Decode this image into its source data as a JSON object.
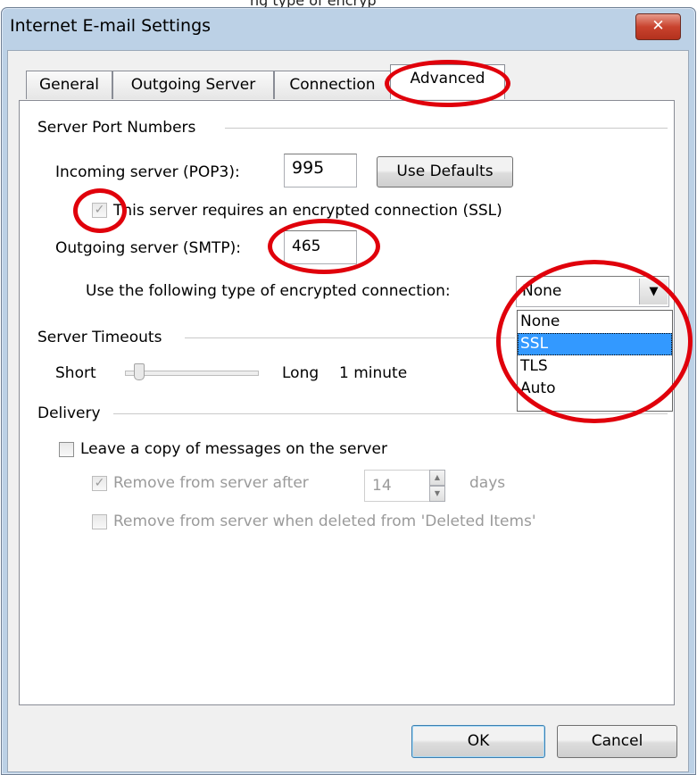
{
  "clipped_caption": "ng type of encryp",
  "window": {
    "title": "Internet E-mail Settings",
    "close_glyph": "✕"
  },
  "tabs": [
    {
      "label": "General",
      "active": false
    },
    {
      "label": "Outgoing Server",
      "active": false
    },
    {
      "label": "Connection",
      "active": false
    },
    {
      "label": "Advanced",
      "active": true
    }
  ],
  "server_ports": {
    "group_label": "Server Port Numbers",
    "incoming_label": "Incoming server (POP3):",
    "incoming_value": "995",
    "use_defaults_label": "Use Defaults",
    "ssl_required": {
      "label": "This server requires an encrypted connection (SSL)",
      "checked": true,
      "enabled": false
    },
    "outgoing_label": "Outgoing server (SMTP):",
    "outgoing_value": "465",
    "encryption_label": "Use the following type of encrypted connection:",
    "encryption_selected": "None",
    "encryption_options": [
      "None",
      "SSL",
      "TLS",
      "Auto"
    ],
    "encryption_highlighted": "SSL"
  },
  "timeouts": {
    "group_label": "Server Timeouts",
    "short_label": "Short",
    "long_label": "Long",
    "value_label": "1 minute"
  },
  "delivery": {
    "group_label": "Delivery",
    "leave_copy": {
      "label": "Leave a copy of messages on the server",
      "checked": false
    },
    "remove_after": {
      "label": "Remove from server after",
      "checked": true,
      "enabled": false,
      "days_value": "14",
      "days_label": "days"
    },
    "remove_when_deleted": {
      "label": "Remove from server when deleted from 'Deleted Items'",
      "checked": false,
      "enabled": false
    }
  },
  "footer": {
    "ok_label": "OK",
    "cancel_label": "Cancel"
  },
  "colors": {
    "annotation_red": "#e0000b",
    "selection_blue": "#3399ff"
  }
}
